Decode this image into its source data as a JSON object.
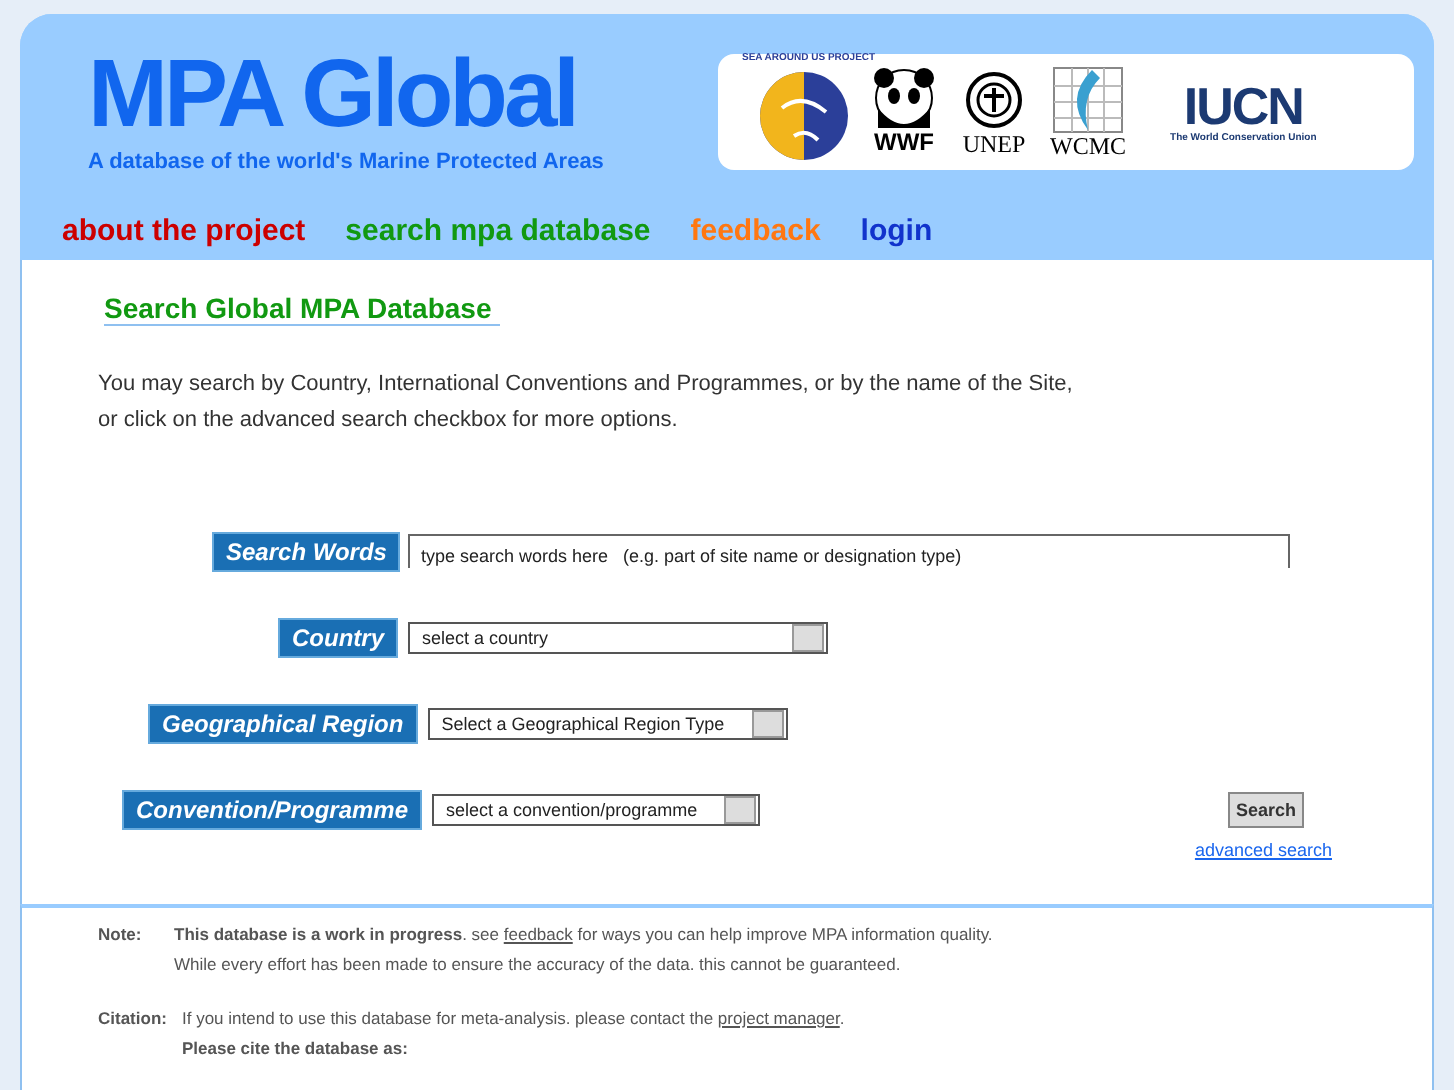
{
  "header": {
    "title": "MPA Global",
    "tagline": "A database of the world's Marine Protected Areas",
    "logos": [
      {
        "kind": "seaaround",
        "text": "SEA AROUND US PROJECT"
      },
      {
        "kind": "wwf",
        "text": "WWF"
      },
      {
        "kind": "unep",
        "text": "UNEP"
      },
      {
        "kind": "wcmc",
        "text": "WCMC"
      },
      {
        "kind": "iucn",
        "text": "IUCN",
        "subtext": "The World Conservation Union"
      }
    ]
  },
  "nav": [
    {
      "label": "about the project",
      "color": "#cc0000"
    },
    {
      "label": "search mpa database",
      "color": "#119911"
    },
    {
      "label": "feedback",
      "color": "#ff7711"
    },
    {
      "label": "login",
      "color": "#1133cc"
    }
  ],
  "heading": "Search Global MPA Database",
  "intro": [
    "You may search by Country, International Conventions and Programmes, or by the name of the Site,",
    "or click on the advanced search checkbox for more options."
  ],
  "fields": [
    {
      "label": "Search Words",
      "kind": "text",
      "placeholder": "type search words here   (e.g. part of site name or designation type)"
    },
    {
      "label": "Country",
      "kind": "select",
      "value": "select a country"
    },
    {
      "label": "Geographical Region",
      "kind": "select",
      "value": "Select a Geographical Region Type"
    },
    {
      "label": "Convention/Programme",
      "kind": "select",
      "value": "select a convention/programme"
    }
  ],
  "search_button": "Search",
  "advanced_link": "advanced search",
  "notes": [
    {
      "label": "Note:",
      "lines": [
        {
          "bold": "This database is a work in progress",
          "before": ". see ",
          "link": "feedback",
          "after": " for ways you can help improve MPA information quality."
        },
        {
          "before": "While every effort has been made to ensure the accuracy of the data. this cannot be guaranteed."
        }
      ]
    },
    {
      "label": "Citation:",
      "lines": [
        {
          "before": "If you intend to use this database for meta-analysis. please contact the ",
          "link": "project manager",
          "after": "."
        },
        {
          "bold": "Please cite the database as:"
        }
      ]
    }
  ]
}
